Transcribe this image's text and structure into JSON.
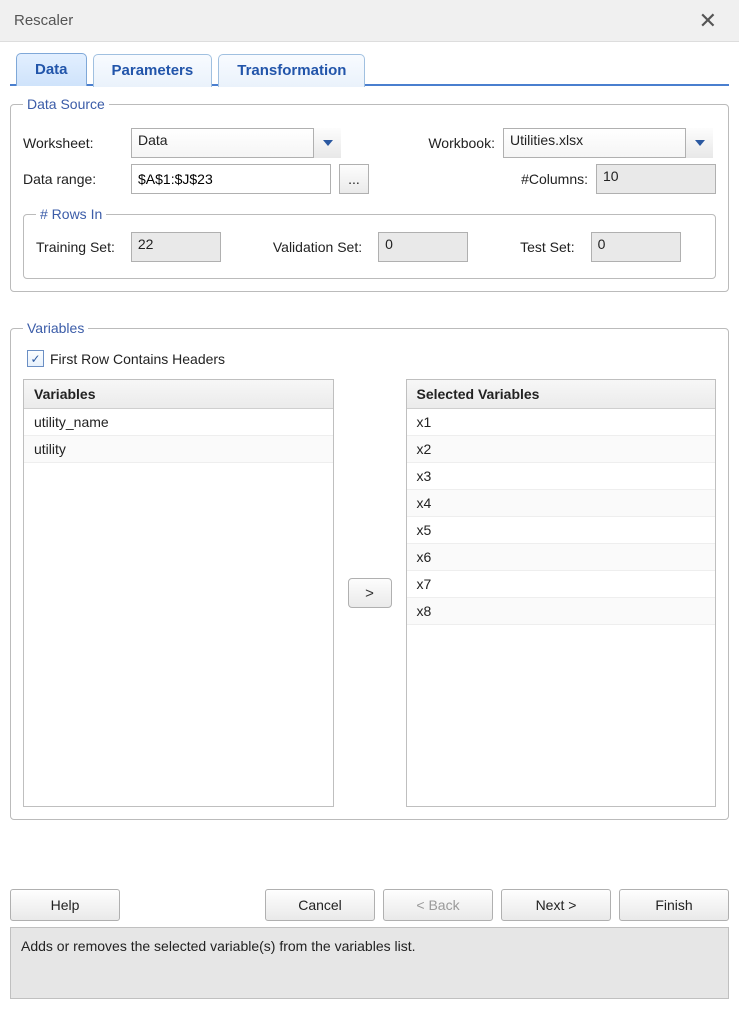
{
  "window": {
    "title": "Rescaler"
  },
  "tabs": {
    "data": "Data",
    "parameters": "Parameters",
    "transformation": "Transformation"
  },
  "dataSource": {
    "legend": "Data Source",
    "worksheet_label": "Worksheet:",
    "worksheet_value": "Data",
    "workbook_label": "Workbook:",
    "workbook_value": "Utilities.xlsx",
    "datarange_label": "Data range:",
    "datarange_value": "$A$1:$J$23",
    "columns_label": "#Columns:",
    "columns_value": "10",
    "rowsIn": {
      "legend": "# Rows In",
      "training_label": "Training Set:",
      "training_value": "22",
      "validation_label": "Validation Set:",
      "validation_value": "0",
      "test_label": "Test Set:",
      "test_value": "0"
    }
  },
  "variables": {
    "legend": "Variables",
    "first_row_headers_label": "First Row Contains Headers",
    "move_btn": ">",
    "available_header": "Variables",
    "available": [
      "utility_name",
      "utility"
    ],
    "selected_header": "Selected Variables",
    "selected": [
      "x1",
      "x2",
      "x3",
      "x4",
      "x5",
      "x6",
      "x7",
      "x8"
    ]
  },
  "buttons": {
    "help": "Help",
    "cancel": "Cancel",
    "back": "< Back",
    "next": "Next >",
    "finish": "Finish",
    "ellipsis": "..."
  },
  "hint": "Adds or removes the selected variable(s) from the variables list."
}
